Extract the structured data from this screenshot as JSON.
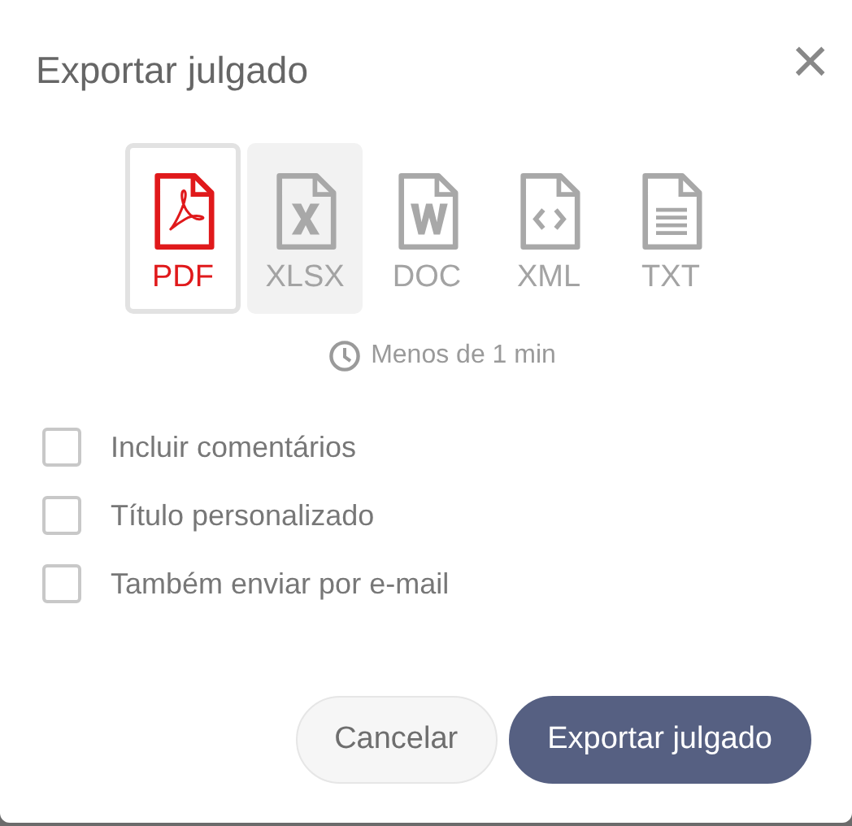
{
  "dialog": {
    "title": "Exportar julgado",
    "close": "×"
  },
  "formats": [
    {
      "kind": "pdf",
      "label": "PDF",
      "selected": true,
      "hovered": false
    },
    {
      "kind": "xlsx",
      "label": "XLSX",
      "selected": false,
      "hovered": true
    },
    {
      "kind": "doc",
      "label": "DOC",
      "selected": false,
      "hovered": false
    },
    {
      "kind": "xml",
      "label": "XML",
      "selected": false,
      "hovered": false
    },
    {
      "kind": "txt",
      "label": "TXT",
      "selected": false,
      "hovered": false
    }
  ],
  "estimate": "Menos de 1 min",
  "options": [
    {
      "label": "Incluir comentários",
      "checked": false
    },
    {
      "label": "Título personalizado",
      "checked": false
    },
    {
      "label": "Também enviar por e-mail",
      "checked": false
    }
  ],
  "buttons": [
    {
      "kind": "secondary",
      "label": "Cancelar"
    },
    {
      "kind": "primary",
      "label": "Exportar julgado"
    }
  ]
}
